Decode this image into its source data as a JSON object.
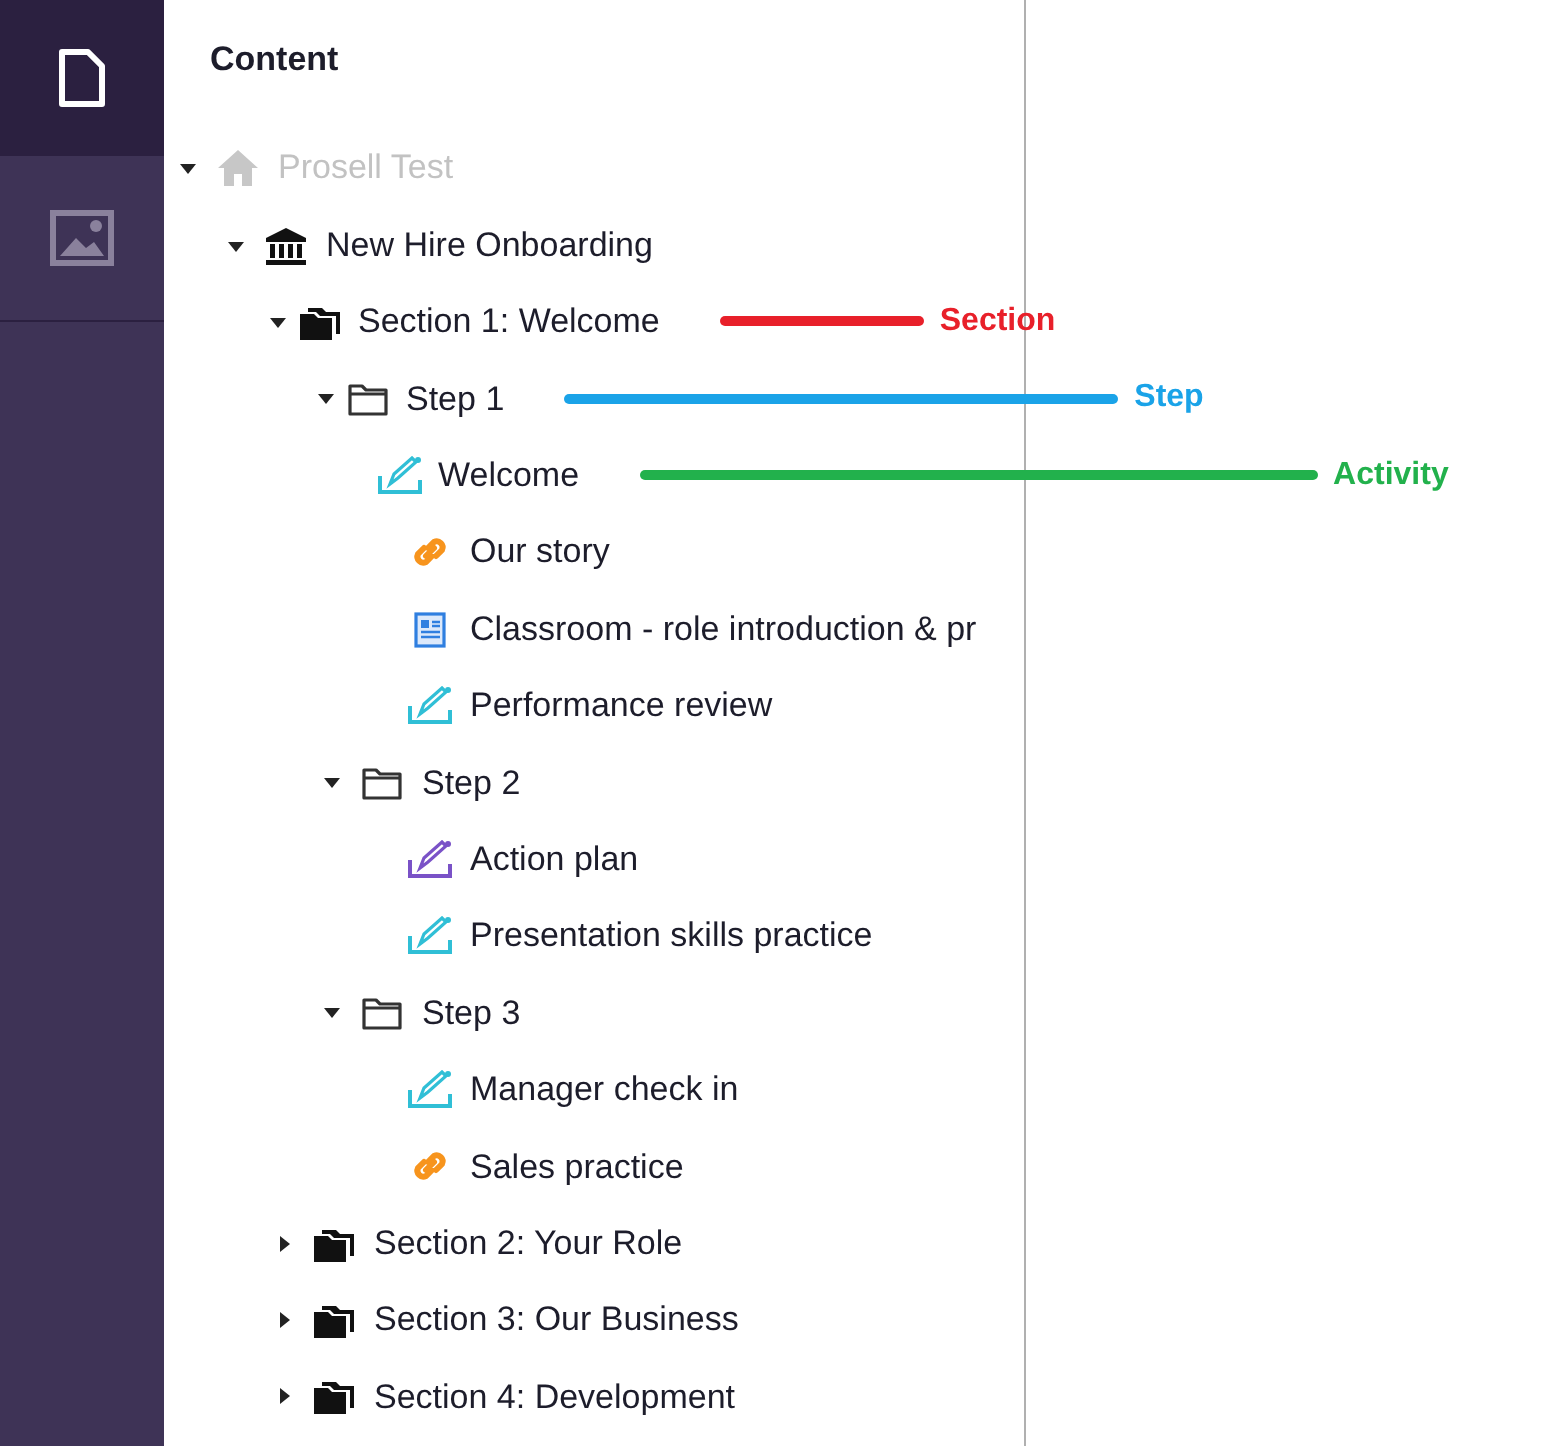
{
  "sidebar": {
    "items": [
      {
        "kind": "document",
        "selected": true
      },
      {
        "kind": "image",
        "selected": false
      }
    ]
  },
  "panel": {
    "title": "Content"
  },
  "tree": [
    {
      "label": "Prosell Test",
      "kind": "home",
      "disabled": true,
      "expanded": true,
      "children": [
        {
          "label": "New Hire Onboarding",
          "kind": "course",
          "disabled": false,
          "expanded": true,
          "children": [
            {
              "label": "Section 1: Welcome",
              "kind": "section",
              "disabled": false,
              "expanded": true,
              "annotation": {
                "label": "Section",
                "color": "#e8202a"
              },
              "children": [
                {
                  "label": "Step 1",
                  "kind": "step",
                  "disabled": false,
                  "expanded": true,
                  "annotation": {
                    "label": "Step",
                    "color": "#1aa3e8"
                  },
                  "children": [
                    {
                      "label": "Welcome",
                      "kind": "assessment",
                      "disabled": false,
                      "annotation": {
                        "label": "Activity",
                        "color": "#22b14c"
                      }
                    },
                    {
                      "label": "Our story",
                      "kind": "link",
                      "disabled": false
                    },
                    {
                      "label": "Classroom - role introduction & pr",
                      "kind": "document",
                      "disabled": false
                    },
                    {
                      "label": "Performance review",
                      "kind": "assessment",
                      "disabled": false
                    }
                  ]
                },
                {
                  "label": "Step 2",
                  "kind": "step",
                  "disabled": false,
                  "expanded": true,
                  "children": [
                    {
                      "label": "Action plan",
                      "kind": "task",
                      "disabled": false
                    },
                    {
                      "label": "Presentation skills practice",
                      "kind": "assessment",
                      "disabled": false
                    }
                  ]
                },
                {
                  "label": "Step 3",
                  "kind": "step",
                  "disabled": false,
                  "expanded": true,
                  "children": [
                    {
                      "label": "Manager check in",
                      "kind": "assessment",
                      "disabled": false
                    },
                    {
                      "label": "Sales practice",
                      "kind": "link",
                      "disabled": false
                    }
                  ]
                }
              ]
            },
            {
              "label": "Section 2: Your Role",
              "kind": "section",
              "disabled": false,
              "expanded": false
            },
            {
              "label": "Section 3: Our Business",
              "kind": "section",
              "disabled": false,
              "expanded": false
            },
            {
              "label": "Section 4: Development",
              "kind": "section",
              "disabled": false,
              "expanded": false
            }
          ]
        }
      ]
    }
  ]
}
